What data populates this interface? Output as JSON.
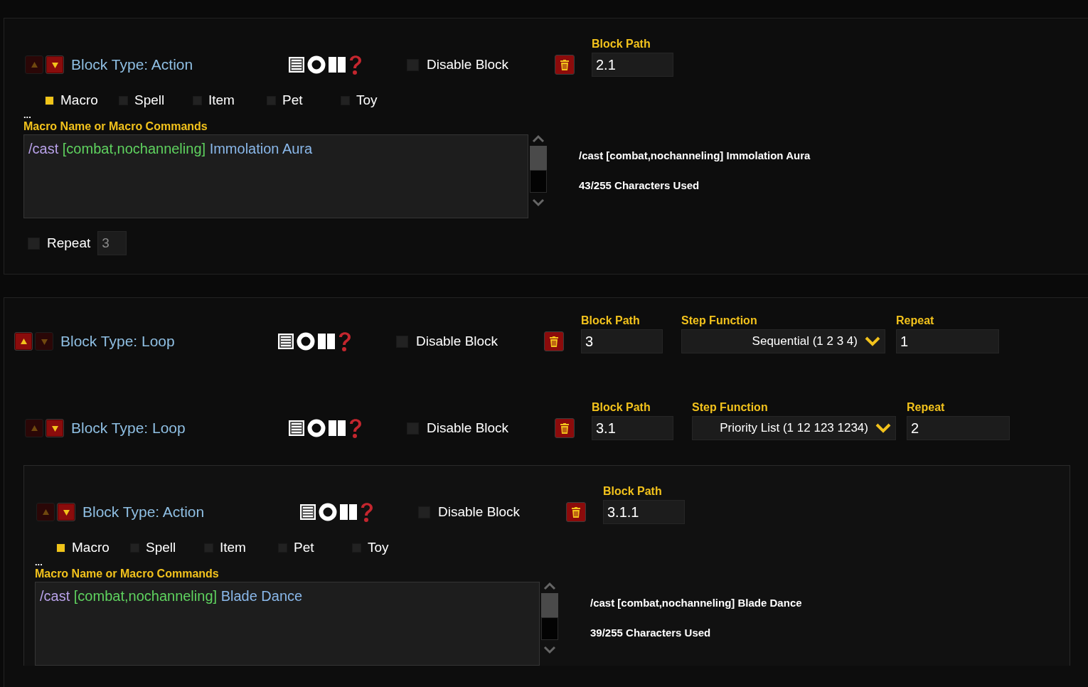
{
  "blocks": [
    {
      "kind": "action",
      "up_enabled": false,
      "down_enabled": true,
      "title": "Block Type: Action",
      "disable_label": "Disable Block",
      "disable_checked": false,
      "path_label": "Block Path",
      "path": "2.1",
      "types": [
        {
          "label": "Macro",
          "selected": true
        },
        {
          "label": "Spell",
          "selected": false
        },
        {
          "label": "Item",
          "selected": false
        },
        {
          "label": "Pet",
          "selected": false
        },
        {
          "label": "Toy",
          "selected": false
        }
      ],
      "ellipsis": "...",
      "macro_label": "Macro Name or Macro Commands",
      "macro": [
        {
          "kind": "command",
          "text": "/cast"
        },
        {
          "kind": "conditional",
          "text": "[combat,nochanneling]"
        },
        {
          "kind": "spell",
          "text": "Immolation Aura"
        }
      ],
      "preview": "/cast [combat,nochanneling] Immolation Aura",
      "chars_used": "43/255 Characters Used",
      "repeat": {
        "label": "Repeat",
        "checked": false,
        "value": "3"
      }
    },
    {
      "kind": "loop",
      "up_enabled": true,
      "down_enabled": false,
      "title": "Block Type: Loop",
      "disable_label": "Disable Block",
      "disable_checked": false,
      "path_label": "Block Path",
      "path": "3",
      "step_label": "Step Function",
      "step": "Sequential (1 2 3 4)",
      "repeat_label": "Repeat",
      "repeat_value": "1",
      "children": [
        {
          "kind": "loop",
          "up_enabled": false,
          "down_enabled": true,
          "title": "Block Type: Loop",
          "disable_label": "Disable Block",
          "disable_checked": false,
          "path_label": "Block Path",
          "path": "3.1",
          "step_label": "Step Function",
          "step": "Priority List (1 12 123 1234)",
          "repeat_label": "Repeat",
          "repeat_value": "2",
          "children": [
            {
              "kind": "action",
              "up_enabled": false,
              "down_enabled": true,
              "title": "Block Type: Action",
              "disable_label": "Disable Block",
              "disable_checked": false,
              "path_label": "Block Path",
              "path": "3.1.1",
              "types": [
                {
                  "label": "Macro",
                  "selected": true
                },
                {
                  "label": "Spell",
                  "selected": false
                },
                {
                  "label": "Item",
                  "selected": false
                },
                {
                  "label": "Pet",
                  "selected": false
                },
                {
                  "label": "Toy",
                  "selected": false
                }
              ],
              "ellipsis": "...",
              "macro_label": "Macro Name or Macro Commands",
              "macro": [
                {
                  "kind": "command",
                  "text": "/cast"
                },
                {
                  "kind": "conditional",
                  "text": "[combat,nochanneling]"
                },
                {
                  "kind": "spell",
                  "text": "Blade Dance"
                }
              ],
              "preview": "/cast [combat,nochanneling] Blade Dance",
              "chars_used": "39/255 Characters Used"
            }
          ]
        }
      ]
    }
  ]
}
